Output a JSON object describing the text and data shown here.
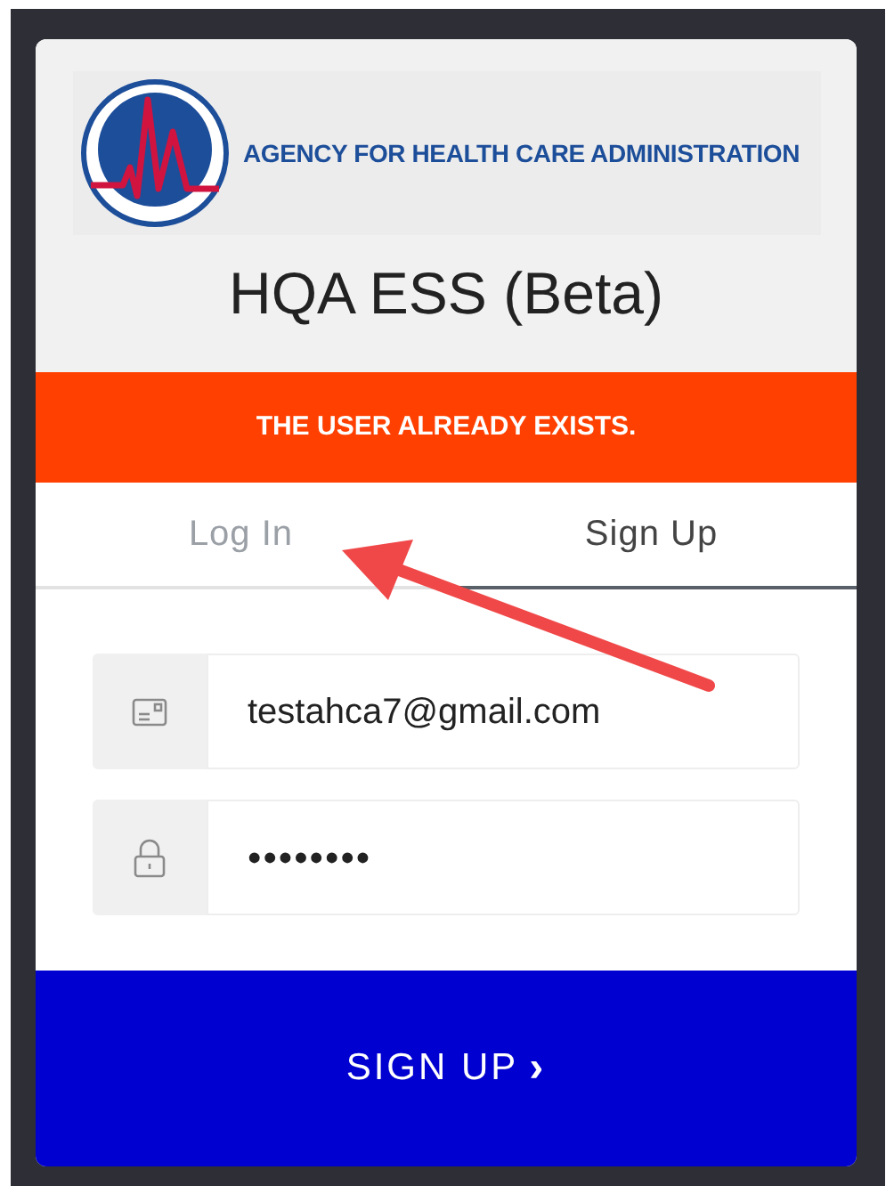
{
  "logo": {
    "text": "AGENCY FOR HEALTH CARE ADMINISTRATION"
  },
  "title": "HQA ESS (Beta)",
  "alert": {
    "message": "THE USER ALREADY EXISTS."
  },
  "tabs": [
    {
      "label": "Log In",
      "selected": false
    },
    {
      "label": "Sign Up",
      "selected": true
    }
  ],
  "fields": [
    {
      "kind": "email",
      "value": "testahca7@gmail.com"
    },
    {
      "kind": "password",
      "value": "••••••••"
    }
  ],
  "submit": {
    "label": "SIGN UP",
    "icon": "›"
  },
  "annotation": {
    "kind": "arrow"
  }
}
